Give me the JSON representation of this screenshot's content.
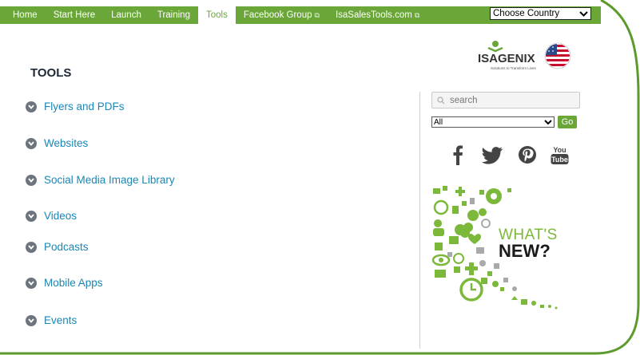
{
  "nav": {
    "items": [
      {
        "label": "Home"
      },
      {
        "label": "Start Here"
      },
      {
        "label": "Launch"
      },
      {
        "label": "Training"
      },
      {
        "label": "Tools"
      },
      {
        "label": "Facebook Group"
      },
      {
        "label": "IsaSalesTools.com"
      }
    ],
    "active": "Tools",
    "country_label": "Choose Country"
  },
  "logo": {
    "brand": "ISAGENIX",
    "tagline": "Solutions to Transform Lives"
  },
  "page_title": "TOOLS",
  "tools": [
    "Flyers and PDFs",
    "Websites",
    "Social Media Image Library",
    "Videos",
    "Podcasts",
    "Mobile Apps",
    "Events"
  ],
  "sidebar": {
    "search_placeholder": "search",
    "filter_value": "All",
    "go_label": "Go",
    "social_icons": [
      "facebook-icon",
      "twitter-icon",
      "pinterest-icon",
      "youtube-icon"
    ],
    "whats_new_line1": "WHAT'S",
    "whats_new_line2": "NEW?"
  },
  "colors": {
    "brand_green": "#6aa738",
    "link_blue": "#1a87b5",
    "title_dark": "#1c2833"
  }
}
